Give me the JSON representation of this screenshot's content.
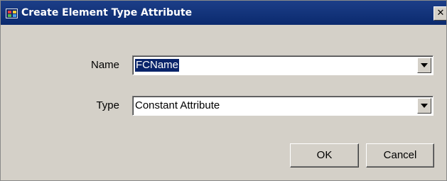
{
  "window": {
    "title": "Create Element Type Attribute",
    "close_glyph": "✕",
    "title_icon": "app-window-icon"
  },
  "form": {
    "name_label": "Name",
    "name_value": "FCName",
    "type_label": "Type",
    "type_value": "Constant Attribute"
  },
  "buttons": {
    "ok_label": "OK",
    "cancel_label": "Cancel"
  },
  "colors": {
    "titlebar": "#0a246a",
    "dialog_bg": "#d4d0c8",
    "selection": "#0a246a"
  }
}
